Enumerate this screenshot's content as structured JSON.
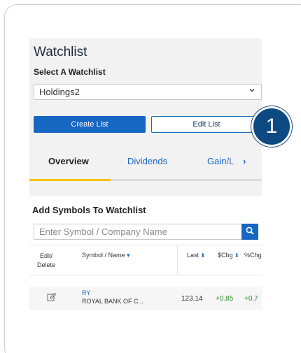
{
  "watchlist": {
    "title": "Watchlist",
    "select_label": "Select A Watchlist",
    "selected_value": "Holdings2",
    "create_button": "Create List",
    "edit_button": "Edit List"
  },
  "tabs": {
    "overview": "Overview",
    "dividends": "Dividends",
    "gain": "Gain/L",
    "more_arrow": "›"
  },
  "add_symbols": {
    "title": "Add Symbols To Watchlist",
    "placeholder": "Enter Symbol / Company Name"
  },
  "table": {
    "headers": {
      "edit_line1": "Edit/",
      "edit_line2": "Delete",
      "symbol": "Symbol / Name",
      "last": "Last",
      "chg": "$Chg",
      "pct": "%Chg"
    },
    "rows": [
      {
        "symbol": "RY",
        "name": "ROYAL BANK OF C...",
        "last": "123.14",
        "chg": "+0.85",
        "pct": "+0.7"
      }
    ]
  },
  "callout": {
    "number": "1"
  },
  "colors": {
    "primary_blue": "#1766c2",
    "badge_navy": "#0e4a82",
    "tab_indicator": "#f5c211",
    "positive_green": "#2e8b2e"
  },
  "icons": {
    "select_chevron": "chevron-down-icon",
    "search": "search-icon",
    "edit": "pencil-edit-icon",
    "sort": "sort-updown-icon"
  }
}
